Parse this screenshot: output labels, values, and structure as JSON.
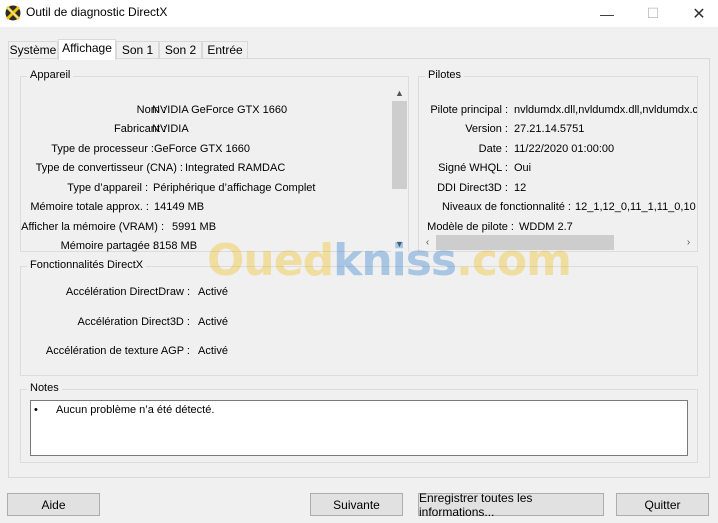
{
  "window": {
    "title": "Outil de diagnostic DirectX",
    "min_glyph": "—",
    "max_glyph": "☐",
    "close_glyph": "✕"
  },
  "tabs": [
    {
      "label": "Système",
      "active": false
    },
    {
      "label": "Affichage",
      "active": true
    },
    {
      "label": "Son 1",
      "active": false
    },
    {
      "label": "Son 2",
      "active": false
    },
    {
      "label": "Entrée",
      "active": false
    }
  ],
  "device": {
    "title": "Appareil",
    "rows": [
      {
        "label": "Nom :",
        "value": "NVIDIA GeForce GTX 1660"
      },
      {
        "label": "Fabricant :",
        "value": "NVIDIA"
      },
      {
        "label": "Type de processeur :",
        "value": "GeForce GTX 1660"
      },
      {
        "label": "Type de convertisseur (CNA) :",
        "value": "Integrated RAMDAC"
      },
      {
        "label": "Type d’appareil :",
        "value": "Périphérique d’affichage Complet"
      },
      {
        "label": "Mémoire totale approx. :",
        "value": "14149 MB"
      },
      {
        "label": "Afficher la mémoire (VRAM) :",
        "value": "5991 MB"
      },
      {
        "label": "Mémoire partagée :",
        "value": "8158 MB"
      }
    ]
  },
  "drivers": {
    "title": "Pilotes",
    "rows": [
      {
        "label": "Pilote principal :",
        "value": "nvldumdx.dll,nvldumdx.dll,nvldumdx.c"
      },
      {
        "label": "Version :",
        "value": "27.21.14.5751"
      },
      {
        "label": "Date :",
        "value": "11/22/2020 01:00:00"
      },
      {
        "label": "Signé WHQL :",
        "value": "Oui"
      },
      {
        "label": "DDI Direct3D :",
        "value": "12"
      },
      {
        "label": "Niveaux de fonctionnalité :",
        "value": "12_1,12_0,11_1,11_0,10"
      },
      {
        "label": "Modèle de pilote :",
        "value": "WDDM 2.7"
      }
    ]
  },
  "features": {
    "title": "Fonctionnalités DirectX",
    "rows": [
      {
        "label": "Accélération DirectDraw :",
        "value": "Activé"
      },
      {
        "label": "Accélération Direct3D :",
        "value": "Activé"
      },
      {
        "label": "Accélération de texture AGP :",
        "value": "Activé"
      }
    ]
  },
  "notes": {
    "title": "Notes",
    "items": [
      "Aucun problème n’a été détecté."
    ]
  },
  "buttons": {
    "help": "Aide",
    "next": "Suivante",
    "save_all": "Enregistrer toutes les informations...",
    "quit": "Quitter"
  },
  "watermark": {
    "part1": "Oued",
    "part2": "kniss",
    "part3": ".com"
  },
  "colors": {
    "watermark_yellow": "#f0b800",
    "watermark_blue": "#1a73c9"
  }
}
